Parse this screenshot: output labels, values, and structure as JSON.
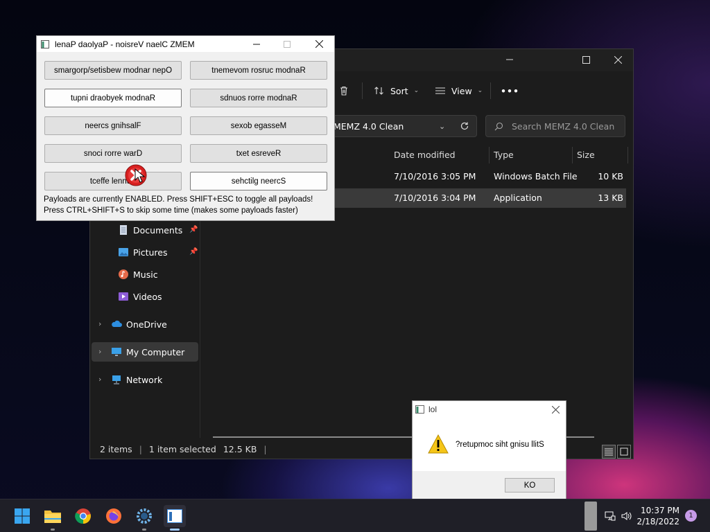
{
  "memz": {
    "title": "lenaP daolyaP - noisreV naelC ZMEM",
    "buttons": [
      "smargorp/setisbew modnar nepO",
      "tnemevom rosruc modnaR",
      "tupni draobyek modnaR",
      "sdnuos rorre modnaR",
      "neercs gnihsalF",
      "sexob egasseM",
      "snoci rorre warD",
      "txet esreveR",
      "tceffe lennuT",
      "sehctilg neercS"
    ],
    "status_line1": "Payloads are currently ENABLED. Press SHIFT+ESC to toggle all payloads!",
    "status_line2": "Press CTRL+SHIFT+S to skip some time (makes some payloads faster)"
  },
  "explorer": {
    "toolbar": {
      "sort": "Sort",
      "view": "View",
      "more": "•••"
    },
    "address": "MEMZ 4.0 Clean",
    "search_placeholder": "Search MEMZ 4.0 Clean",
    "columns": {
      "date": "Date modified",
      "type": "Type",
      "size": "Size"
    },
    "files": [
      {
        "date": "7/10/2016 3:05 PM",
        "type": "Windows Batch File",
        "size": "10 KB"
      },
      {
        "date": "7/10/2016 3:04 PM",
        "type": "Application",
        "size": "13 KB"
      }
    ],
    "nav": {
      "documents": "Documents",
      "pictures": "Pictures",
      "music": "Music",
      "videos": "Videos",
      "onedrive": "OneDrive",
      "my_computer": "My Computer",
      "network": "Network"
    },
    "status": {
      "items": "2 items",
      "selected": "1 item selected",
      "size": "12.5 KB"
    }
  },
  "msgbox": {
    "title": "lol",
    "text": "?retupmoc siht gnisu llitS",
    "ok": "KO"
  },
  "taskbar": {
    "time": "10:37 PM",
    "date": "2/18/2022",
    "notifications": "1",
    "apps": [
      "start-icon",
      "file-explorer-icon",
      "chrome-icon",
      "firefox-icon",
      "settings-icon",
      "memz-app-icon"
    ]
  },
  "colors": {
    "accent": "#0078d4",
    "selected_row": "#3a3a3a",
    "notif_badge": "#c79be8"
  }
}
